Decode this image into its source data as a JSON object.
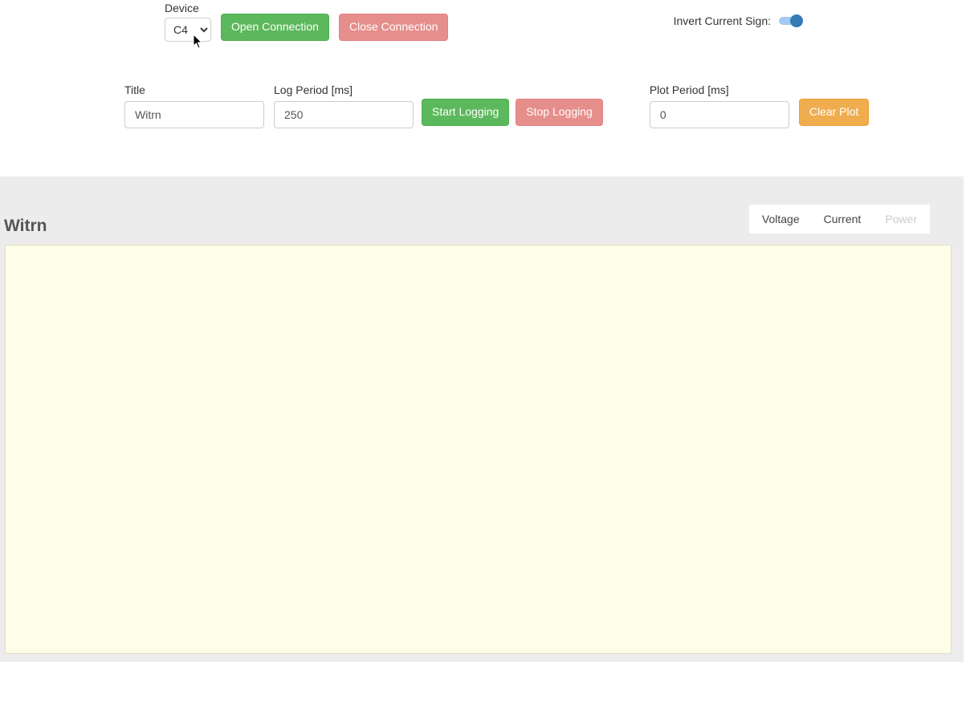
{
  "device": {
    "label": "Device",
    "selected": "C4"
  },
  "buttons": {
    "open_connection": "Open Connection",
    "close_connection": "Close Connection",
    "start_logging": "Start Logging",
    "stop_logging": "Stop Logging",
    "clear_plot": "Clear Plot"
  },
  "invert": {
    "label": "Invert Current Sign:",
    "state": "on"
  },
  "fields": {
    "title": {
      "label": "Title",
      "value": "Witrn"
    },
    "log_period": {
      "label": "Log Period [ms]",
      "value": "250"
    },
    "plot_period": {
      "label": "Plot Period [ms]",
      "value": "0"
    }
  },
  "plot": {
    "title": "Witrn",
    "legend": {
      "voltage": "Voltage",
      "current": "Current",
      "power": "Power"
    }
  },
  "chart_data": {
    "type": "line",
    "title": "Witrn",
    "series": [
      {
        "name": "Voltage",
        "values": []
      },
      {
        "name": "Current",
        "values": []
      },
      {
        "name": "Power",
        "values": []
      }
    ],
    "x": [],
    "xlabel": "",
    "ylabel": "",
    "legend_position": "top-right"
  }
}
